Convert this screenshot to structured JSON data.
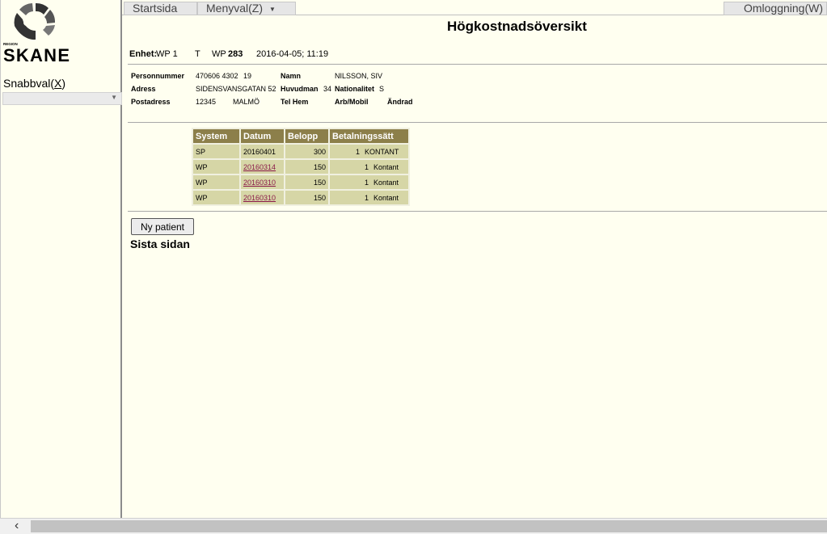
{
  "sidebar": {
    "logo_top_text": "REGION",
    "logo_text": "SKANE",
    "snabbval_label": "Snabbval(",
    "snabbval_key": "X",
    "snabbval_close": ")"
  },
  "menubar": {
    "start": "Startsida",
    "menyval": "Menyval(Z)",
    "logout": "Omloggning(W)"
  },
  "page_title": "Högkostnadsöversikt",
  "unit_row": {
    "enhet_label": "Enhet:",
    "enhet_value": "WP 1",
    "t": "T",
    "wp_label": "WP",
    "wp_value": "283",
    "timestamp": "2016-04-05; 11:19"
  },
  "patient": {
    "personnummer_label": "Personnummer",
    "personnummer": "470606 4302",
    "personnummer_extra": "19",
    "namn_label": "Namn",
    "namn": "NILSSON, SIV",
    "adress_label": "Adress",
    "adress": "SIDENSVANSGATAN 52",
    "huvudman_label": "Huvudman",
    "huvudman": "34",
    "nationalitet_label": "Nationalitet",
    "nationalitet": "S",
    "postadress_label": "Postadress",
    "postnr": "12345",
    "ort": "MALMÖ",
    "telhem_label": "Tel Hem",
    "arbmobil_label": "Arb/Mobil",
    "andrad_label": "Ändrad"
  },
  "payments": {
    "headers": [
      "System",
      "Datum",
      "Belopp",
      "Betalningssätt"
    ],
    "rows": [
      {
        "system": "SP",
        "datum": "20160401",
        "link": false,
        "belopp": "300",
        "antal": "1",
        "satt": "KONTANT"
      },
      {
        "system": "WP",
        "datum": "20160314",
        "link": true,
        "belopp": "150",
        "antal": "1",
        "satt": "Kontant"
      },
      {
        "system": "WP",
        "datum": "20160310",
        "link": true,
        "belopp": "150",
        "antal": "1",
        "satt": "Kontant"
      },
      {
        "system": "WP",
        "datum": "20160310",
        "link": true,
        "belopp": "150",
        "antal": "1",
        "satt": "Kontant"
      }
    ]
  },
  "ny_patient": "Ny patient",
  "sista_sidan": "Sista sidan",
  "colors": {
    "background": "#fffff0",
    "table_header": "#8c7f4a",
    "table_cell": "#d6d6a6",
    "link": "#8b1a4a"
  }
}
